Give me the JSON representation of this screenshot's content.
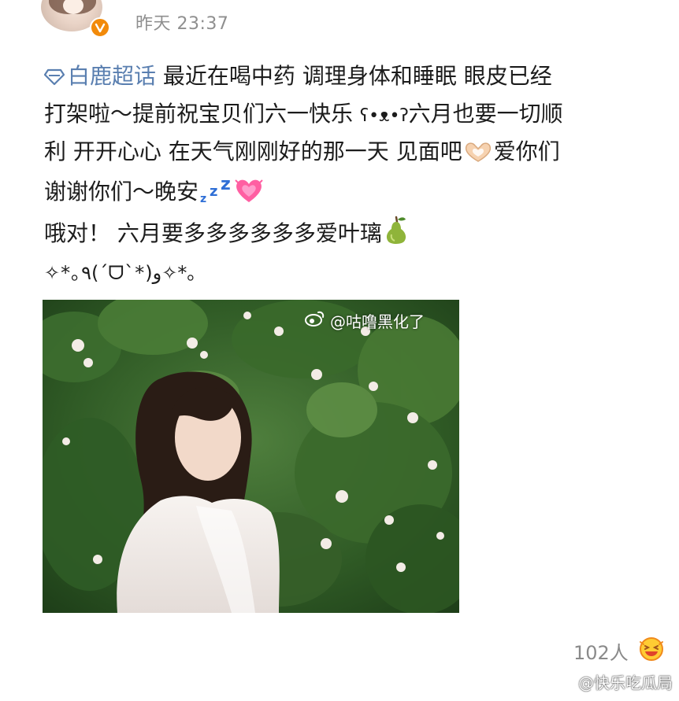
{
  "header": {
    "timestamp": "昨天 23:37"
  },
  "post": {
    "topic_label": "白鹿超话",
    "line1_rest": "  最近在喝中药 调理身体和睡眠 眼皮已经",
    "line2_text": "打架啦～提前祝宝贝们六一快乐 ",
    "line2_kaomoji": "ʕ•ᴥ•ʔ",
    "line2_rest": "六月也要一切顺",
    "line3_text": "利 开开心心 在天气刚刚好的那一天 见面吧",
    "line3_rest": "爱你们",
    "line4_text": "谢谢你们～晚安",
    "line5_text": "哦对！ 六月要多多多多多多爱叶璃",
    "line6_kaomoji": "✧*｡٩(ˊᗜˋ*)و✧*｡"
  },
  "photo": {
    "watermark": "@咕噜黑化了"
  },
  "footer": {
    "reaction_count": "102人",
    "bottom_watermark": "@快乐吃瓜局"
  },
  "icons": {
    "topic": "super-topic-diamond-icon",
    "vip": "verified-v-badge-icon",
    "heart_hands": "heart-hands-emoji-icon",
    "sleep": "zzz-emoji-icon",
    "heart": "growing-heart-emoji-icon",
    "pear": "pear-emoji-icon",
    "reaction": "laughing-face-reaction-icon",
    "weibo": "weibo-logo-icon"
  },
  "colors": {
    "topic": "#5a7fb0",
    "timestamp": "#8f8f8f",
    "vip_badge": "#f28a0a",
    "heart": "#ff5fa2",
    "zzz": "#2f6fd6",
    "pear": "#8fb43a"
  }
}
